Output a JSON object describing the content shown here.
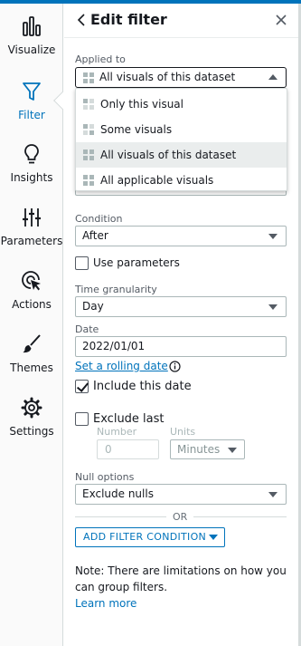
{
  "colors": {
    "accent": "#0073bb",
    "text": "#16191f",
    "muted": "#545b64",
    "border": "#aab7b8"
  },
  "rail": {
    "items": [
      {
        "label": "Visualize",
        "icon": "bar-chart-icon",
        "active": false
      },
      {
        "label": "Filter",
        "icon": "funnel-icon",
        "active": true
      },
      {
        "label": "Insights",
        "icon": "lightbulb-icon",
        "active": false
      },
      {
        "label": "Parameters",
        "icon": "sliders-icon",
        "active": false
      },
      {
        "label": "Actions",
        "icon": "cursor-target-icon",
        "active": false
      },
      {
        "label": "Themes",
        "icon": "brush-icon",
        "active": false
      },
      {
        "label": "Settings",
        "icon": "gear-icon",
        "active": false
      }
    ]
  },
  "panel": {
    "title": "Edit filter",
    "applied_to": {
      "label": "Applied to",
      "value": "All visuals of this dataset",
      "options": [
        {
          "label": "Only this visual",
          "selected": false
        },
        {
          "label": "Some visuals",
          "selected": false
        },
        {
          "label": "All visuals of this dataset",
          "selected": true
        },
        {
          "label": "All applicable visuals",
          "selected": false
        }
      ]
    },
    "condition": {
      "label": "Condition",
      "value": "After"
    },
    "use_parameters": {
      "label": "Use parameters",
      "checked": false
    },
    "time_granularity": {
      "label": "Time granularity",
      "value": "Day"
    },
    "date": {
      "label": "Date",
      "value": "2022/01/01"
    },
    "rolling_date_link": "Set a rolling date",
    "include_date": {
      "label": "Include this date",
      "checked": true
    },
    "exclude_last": {
      "label": "Exclude last",
      "checked": false,
      "number_label": "Number",
      "number_placeholder": "0",
      "units_label": "Units",
      "units_value": "Minutes"
    },
    "null_options": {
      "label": "Null options",
      "value": "Exclude nulls"
    },
    "or_text": "OR",
    "add_condition_label": "ADD FILTER CONDITION",
    "note": "Note: There are limitations on how you can group filters.",
    "learn_more": "Learn more"
  }
}
